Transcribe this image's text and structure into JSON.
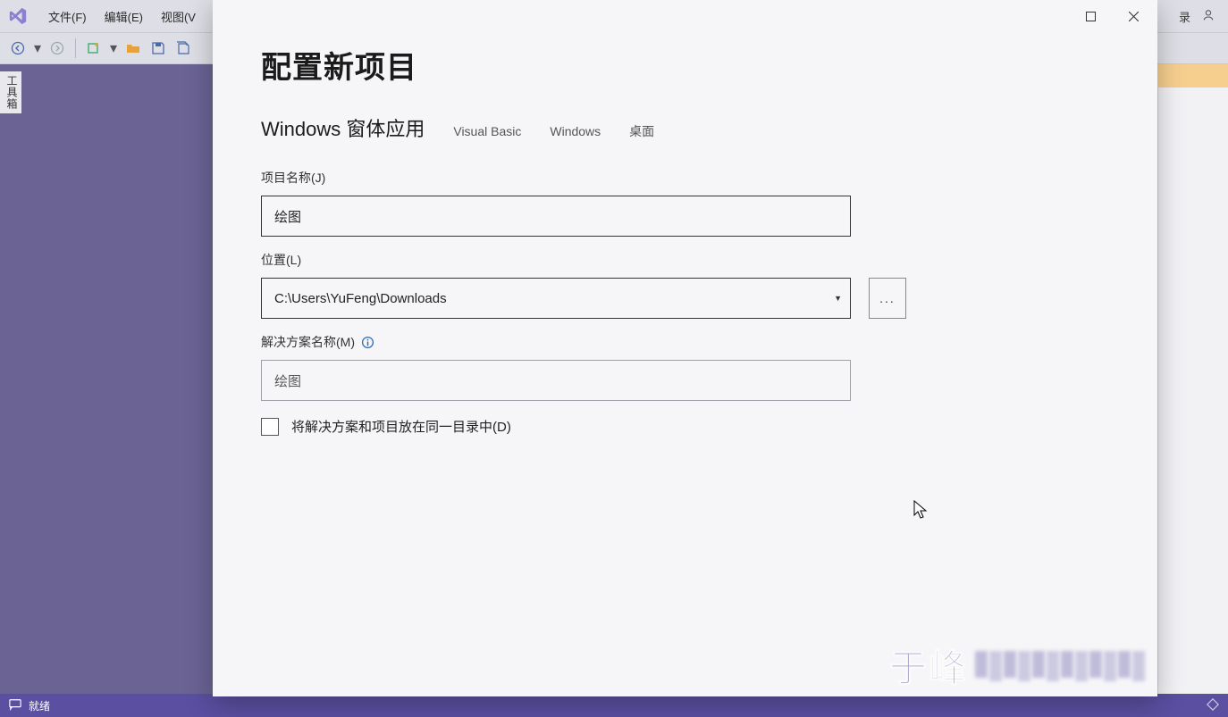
{
  "vs": {
    "menu": {
      "file": "文件(F)",
      "edit": "编辑(E)",
      "view": "视图(V"
    },
    "right_text": "录",
    "side_tool": "工具箱",
    "status": "就绪"
  },
  "dialog": {
    "heading": "配置新项目",
    "subhead": "Windows 窗体应用",
    "tags": [
      "Visual Basic",
      "Windows",
      "桌面"
    ],
    "project_name_label": "项目名称(J)",
    "project_name_value": "绘图",
    "location_label": "位置(L)",
    "location_value": "C:\\Users\\YuFeng\\Downloads",
    "browse_label": "...",
    "solution_name_label": "解决方案名称(M)",
    "solution_name_value": "绘图",
    "same_dir_label": "将解决方案和项目放在同一目录中(D)",
    "same_dir_checked": false
  },
  "watermark": "于峰"
}
